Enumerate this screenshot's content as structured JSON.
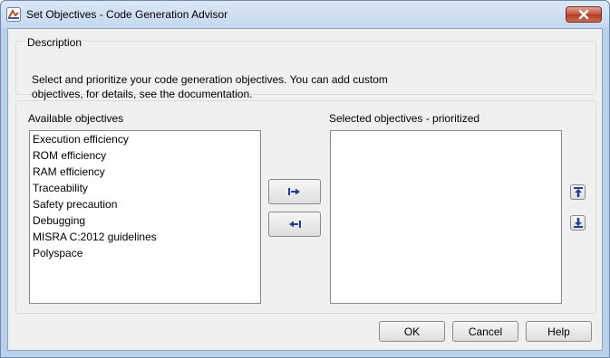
{
  "window": {
    "title": "Set Objectives - Code Generation Advisor",
    "app_icon": "matlab-icon",
    "close_icon": "close-icon"
  },
  "description": {
    "caption": "Description",
    "line1": "Select and prioritize your code generation objectives. You can add custom",
    "line2": "objectives, for details, see the documentation."
  },
  "available": {
    "label": "Available objectives",
    "items": [
      "Execution efficiency",
      "ROM efficiency",
      "RAM efficiency",
      "Traceability",
      "Safety precaution",
      "Debugging",
      "MISRA C:2012 guidelines",
      "Polyspace"
    ]
  },
  "selected": {
    "label": "Selected objectives - prioritized",
    "items": []
  },
  "transfer": {
    "add_icon": "arrow-right-icon",
    "remove_icon": "arrow-left-icon"
  },
  "priority": {
    "up_icon": "move-up-icon",
    "down_icon": "move-down-icon"
  },
  "footer": {
    "ok_label": "OK",
    "cancel_label": "Cancel",
    "help_label": "Help"
  },
  "colors": {
    "accent": "#1f3f9a",
    "title_bar": "#c4d8ef",
    "client_bg": "#f0f0f0",
    "close_button": "#c74f38"
  }
}
